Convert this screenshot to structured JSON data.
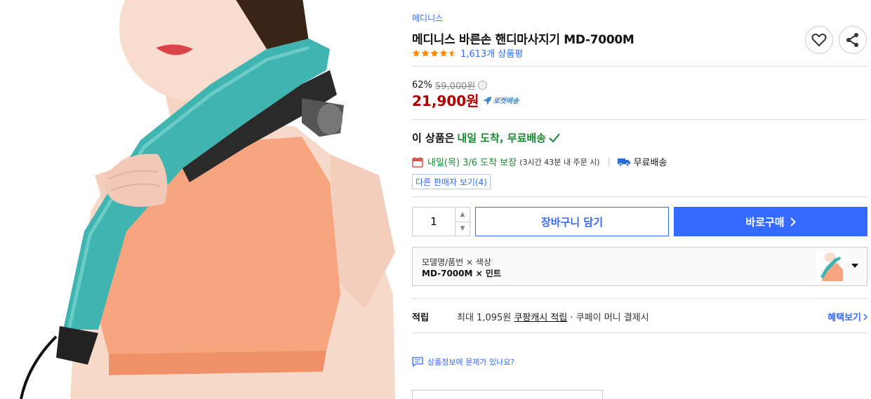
{
  "product": {
    "brand": "메디니스",
    "title": "메디니스 바른손 핸디마사지기 MD-7000M",
    "rating_value": 4.5,
    "review_count": "1,613개 상품평",
    "wishlist_icon": "heart-icon",
    "share_icon": "share-icon"
  },
  "price": {
    "discount_rate": "62%",
    "original": "59,000원",
    "info_icon": "ⓘ",
    "sale": "21,900원",
    "rocket_label": "로켓배송"
  },
  "delivery": {
    "headline_prefix": "이 상품은",
    "headline_green": "내일 도착, 무료배송",
    "date_text": "내일(목) 3/6 도착 보장",
    "cutoff_text": "(3시간 43분 내 주문 시)",
    "free_shipping": "무료배송",
    "other_sellers": "다른 판매자 보기(4)"
  },
  "purchase": {
    "quantity": "1",
    "qty_up": "▲",
    "qty_down": "▼",
    "cart_label": "장바구니 담기",
    "buy_label": "바로구매"
  },
  "option": {
    "label": "모델명/품번 × 색상",
    "value": "MD-7000M × 민트"
  },
  "reward": {
    "label": "적립",
    "text_prefix": "최대 1,095원 ",
    "text_link": "쿠팡캐시 적립",
    "text_suffix": " · 쿠페이 머니 결제시",
    "benefit_label": "혜택보기"
  },
  "report": {
    "label": "상품정보에 문제가 있나요?"
  },
  "colors": {
    "accent": "#346aff",
    "sale_red": "#ae0000",
    "green": "#178a31",
    "device_teal": "#3fb4b0",
    "bra_orange": "#f7a57e"
  }
}
